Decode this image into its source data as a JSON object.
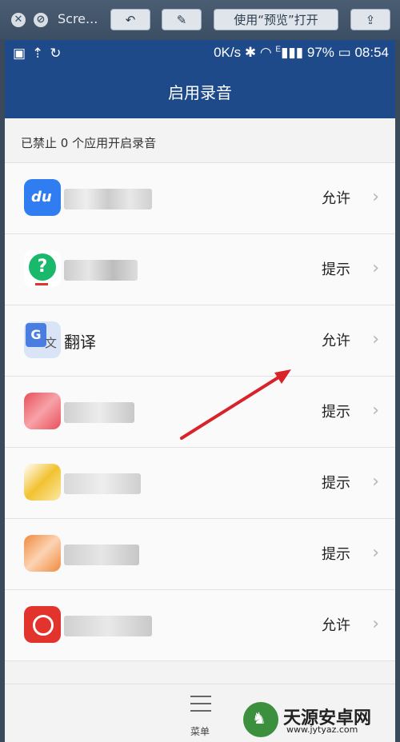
{
  "window": {
    "title": "Scre...",
    "open_with_preview": "使用“预览”打开"
  },
  "status_bar": {
    "network_speed": "0K/s",
    "signal_badge": "E",
    "battery": "97%",
    "time": "08:54"
  },
  "header": {
    "title": "启用录音"
  },
  "subheader": {
    "text": "已禁止 0 个应用开启录音"
  },
  "apps": [
    {
      "name": "",
      "permission": "允许",
      "icon": "baidu-du-icon",
      "color": "#2f7df0"
    },
    {
      "name": "",
      "permission": "提示",
      "icon": "question-chat-icon",
      "color": "#19b86b"
    },
    {
      "name": "翻译",
      "permission": "允许",
      "icon": "google-translate-icon",
      "color": "#4a7de0"
    },
    {
      "name": "",
      "permission": "提示",
      "icon": "blurred-app-icon",
      "color": "#e8505b"
    },
    {
      "name": "",
      "permission": "提示",
      "icon": "blurred-app-icon",
      "color": "#f2c230"
    },
    {
      "name": "",
      "permission": "提示",
      "icon": "blurred-app-icon",
      "color": "#f08a3c"
    },
    {
      "name": "",
      "permission": "允许",
      "icon": "netease-music-icon",
      "color": "#e3332d"
    }
  ],
  "bottom_nav": {
    "menu_label": "菜单"
  },
  "watermark": {
    "cn": "天源安卓网",
    "en": "www.jytyaz.com"
  }
}
